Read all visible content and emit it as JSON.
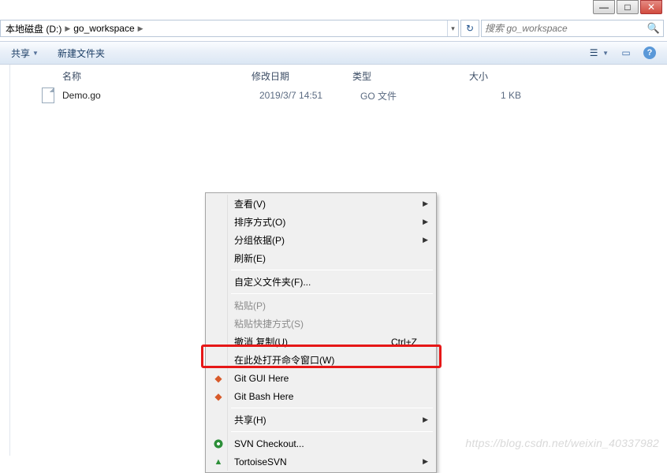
{
  "window": {
    "min": "—",
    "max": "□",
    "close": "✕"
  },
  "breadcrumb": {
    "seg0": "本地磁盘 (D:)",
    "seg1": "go_workspace"
  },
  "search": {
    "placeholder": "搜索 go_workspace"
  },
  "toolbar": {
    "share": "共享",
    "newFolder": "新建文件夹"
  },
  "columns": {
    "name": "名称",
    "date": "修改日期",
    "type": "类型",
    "size": "大小"
  },
  "files": {
    "0": {
      "name": "Demo.go",
      "date": "2019/3/7 14:51",
      "type": "GO 文件",
      "size": "1 KB"
    }
  },
  "ctx": {
    "view": "查看(V)",
    "sort": "排序方式(O)",
    "group": "分组依据(P)",
    "refresh": "刷新(E)",
    "customize": "自定义文件夹(F)...",
    "paste": "粘贴(P)",
    "pasteShortcut": "粘贴快捷方式(S)",
    "undoCopy": "撤消 复制(U)",
    "undoCopyKey": "Ctrl+Z",
    "openCmd": "在此处打开命令窗口(W)",
    "gitGui": "Git GUI Here",
    "gitBash": "Git Bash Here",
    "shareSub": "共享(H)",
    "svnCheckout": "SVN Checkout...",
    "tortoise": "TortoiseSVN"
  },
  "watermark": "https://blog.csdn.net/weixin_40337982"
}
